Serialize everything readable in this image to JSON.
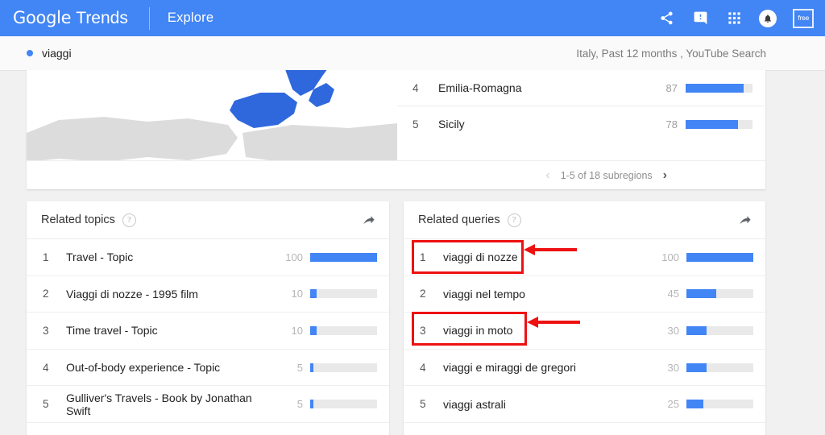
{
  "header": {
    "brand_google": "Google",
    "brand_trends": "Trends",
    "explore_label": "Explore",
    "icons": [
      "share-icon",
      "feedback-icon",
      "apps-grid-icon",
      "notifications-bell-icon",
      "account-avatar"
    ],
    "avatar_text": "free",
    "bar_color": "#4285f4"
  },
  "query_bar": {
    "term": "viaggi",
    "filters": "Italy, Past 12 months , YouTube Search",
    "dot_color": "#4285f4"
  },
  "geo_card": {
    "map_region": "Italy",
    "subregions": [
      {
        "rank": "4",
        "name": "Emilia-Romagna",
        "value": "87",
        "pct": 87
      },
      {
        "rank": "5",
        "name": "Sicily",
        "value": "78",
        "pct": 78
      }
    ],
    "pagination": {
      "prev_icon": "chevron-left-icon",
      "label": "1-5 of 18 subregions",
      "next_icon": "chevron-right-icon"
    }
  },
  "related_topics": {
    "title": "Related topics",
    "help_icon": "help-circle-icon",
    "share_icon": "share-arrow-icon",
    "rows": [
      {
        "rank": "1",
        "name": "Travel - Topic",
        "value": "100",
        "pct": 100
      },
      {
        "rank": "2",
        "name": "Viaggi di nozze - 1995 film",
        "value": "10",
        "pct": 10
      },
      {
        "rank": "3",
        "name": "Time travel - Topic",
        "value": "10",
        "pct": 10
      },
      {
        "rank": "4",
        "name": "Out-of-body experience - Topic",
        "value": "5",
        "pct": 5
      },
      {
        "rank": "5",
        "name": "Gulliver's Travels - Book by Jonathan Swift",
        "value": "5",
        "pct": 5
      }
    ]
  },
  "related_queries": {
    "title": "Related queries",
    "help_icon": "help-circle-icon",
    "share_icon": "share-arrow-icon",
    "rows": [
      {
        "rank": "1",
        "name": "viaggi di nozze",
        "value": "100",
        "pct": 100
      },
      {
        "rank": "2",
        "name": "viaggi nel tempo",
        "value": "45",
        "pct": 45
      },
      {
        "rank": "3",
        "name": "viaggi in moto",
        "value": "30",
        "pct": 30
      },
      {
        "rank": "4",
        "name": "viaggi e miraggi de gregori",
        "value": "30",
        "pct": 30
      },
      {
        "rank": "5",
        "name": "viaggi astrali",
        "value": "25",
        "pct": 25
      }
    ]
  },
  "annotations": {
    "color": "#ee1111",
    "highlight_rows": [
      "viaggi di nozze",
      "viaggi in moto"
    ]
  },
  "colors": {
    "accent": "#4285f4",
    "bar_track": "#e9e9e9",
    "page_bg": "#f1f1f1",
    "card_bg": "#ffffff"
  }
}
